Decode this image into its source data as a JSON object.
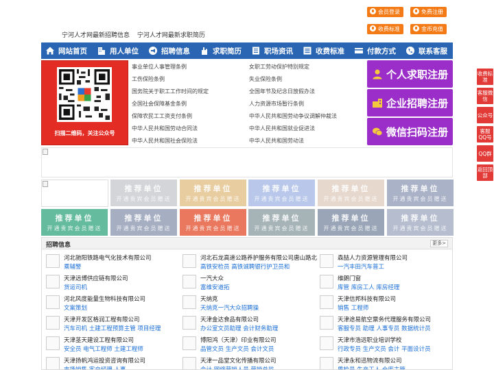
{
  "top_links": [
    "宁河人才网最新招聘信息",
    "宁河人才网最新求职简历"
  ],
  "top_buttons": {
    "member_login": "会员登录",
    "free_register": "免费注册",
    "fee_standard": "收费标准",
    "gold_recharge": "金币充值"
  },
  "nav": [
    "网站首页",
    "用人单位",
    "招聘信息",
    "求职简历",
    "职场资讯",
    "收费标准",
    "付款方式",
    "联系客服"
  ],
  "qr_caption": "扫描二维码，关注公众号",
  "law_links": [
    "事业单位人事管理条例",
    "女职工劳动保护特别规定",
    "工伤保险条例",
    "失业保险条例",
    "国务院关于职工工作时间的规定",
    "全国年节及纪念日放假办法",
    "全国社会保障基金条例",
    "人力资源市场暂行条例",
    "保障农民工工资支付条例",
    "中华人民共和国劳动争议调解仲裁法",
    "中华人民共和国劳动合同法",
    "中华人民共和国就业促进法",
    "中华人民共和国社会保险法",
    "中华人民共和国劳动法"
  ],
  "register": {
    "personal": "个人求职注册",
    "company": "企业招聘注册",
    "wechat": "微信扫码注册"
  },
  "recommend": {
    "title": "推荐单位",
    "sub": "开通贵宾会员赠送"
  },
  "recommend_colors": [
    "#d3d5d8",
    "#e8cda0",
    "#b9c8ea",
    "#e6d8cd",
    "#aab2c8",
    "#65bb9d",
    "#a6aec2",
    "#e9785e",
    "#a6b4b8",
    "#9aa6b8",
    "#b5bdcf"
  ],
  "jobs": {
    "title": "招聘信息",
    "more": "更多>",
    "items": [
      {
        "company": "河北驰阳铁路电气化技术有限公司",
        "positions": "乘辅警"
      },
      {
        "company": "河北石龙高速公路养护服务有限公司唐山路北",
        "positions": "高铁安检员 高铁诚聘银行护卫员和"
      },
      {
        "company": "森喆人力资源管理有限公司",
        "positions": "一汽丰田汽车普工"
      },
      {
        "company": "天津远博供应链有限公司",
        "positions": "货运司机"
      },
      {
        "company": "一汽大众",
        "positions": "富维安道拓"
      },
      {
        "company": "维朗门窗",
        "positions": "库管 库房工人 库房经理"
      },
      {
        "company": "河北风度能量生物科技有限公司",
        "positions": "文案策划"
      },
      {
        "company": "天纳克",
        "positions": "天纳克一汽大众招聘操"
      },
      {
        "company": "天津信邦科技有限公司",
        "positions": "销售 工程师"
      },
      {
        "company": "天津开发区格润工程有限公司",
        "positions": "汽车司机 土建工程预算主管 项目经理"
      },
      {
        "company": "天津金达食品有限公司",
        "positions": "办公室文员助理 会计财务助理"
      },
      {
        "company": "天津途易航空票务代理服务有限公司",
        "positions": "客服专员 助理 人事专员 数据统计员"
      },
      {
        "company": "天津茎天建设工程有限公司",
        "positions": "安全员 电气工程师 土建工程师"
      },
      {
        "company": "博阳鸿（天津）印业有限公司",
        "positions": "品管文员 生产文员 会计文员"
      },
      {
        "company": "天津市浩远职业培训学校",
        "positions": "行政专员 生产文员 会计 平面设计员"
      },
      {
        "company": "天津扬帆鸿运投资咨询有限公司",
        "positions": "市场销售 客户经理 人事"
      },
      {
        "company": "天津一品堂文化传播有限公司",
        "positions": "会计 网络营销人员 营销总监"
      },
      {
        "company": "天津永和迅物流有限公司",
        "positions": "质检员 生产工人 仓库主管"
      }
    ]
  },
  "side_buttons": [
    "收费标准",
    "客服微信",
    "公众号",
    "客服QQ号",
    "QQ群",
    "返回顶部"
  ],
  "colors": {
    "nav": "#2a65b3",
    "orange": "#f47a16",
    "purple": "#9b2ec8",
    "red": "#e22c24",
    "side": "#e23a37",
    "link_blue": "#1a6ed6"
  }
}
